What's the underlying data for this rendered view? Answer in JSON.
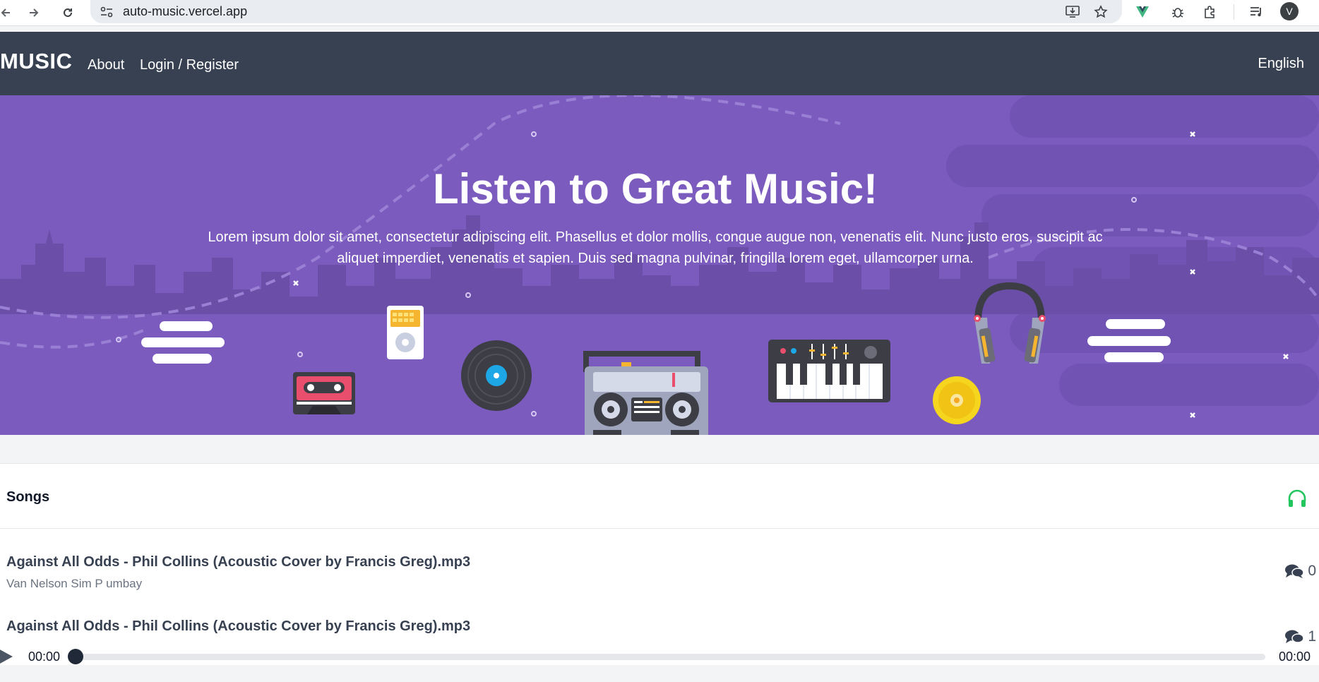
{
  "browser": {
    "url": "auto-music.vercel.app",
    "back_icon": "arrow-left-icon",
    "forward_icon": "arrow-right-icon",
    "reload_icon": "reload-icon",
    "profile_initial": "V"
  },
  "header": {
    "logo": "MUSIC",
    "nav": [
      "About",
      "Login / Register"
    ],
    "language": "English",
    "bg_color": "#374151"
  },
  "hero": {
    "title": "Listen to Great Music!",
    "text": "Lorem ipsum dolor sit amet, consectetur adipiscing elit. Phasellus et dolor mollis, congue augue non, venenatis elit. Nunc justo eros, suscipit ac aliquet imperdiet, venenatis et sapien. Duis sed magna pulvinar, fringilla lorem eget, ullamcorper urna.",
    "bg_color": "#7c5bbf"
  },
  "songs": {
    "title": "Songs",
    "icon": "headphones-icon",
    "icon_color": "#22c55e",
    "items": [
      {
        "title": "Against All Odds - Phil Collins (Acoustic Cover by Francis Greg).mp3",
        "artist": "Van Nelson Sim P umbay",
        "comments": "0"
      },
      {
        "title": "Against All Odds - Phil Collins (Acoustic Cover by Francis Greg).mp3",
        "artist": "",
        "comments": "1"
      }
    ]
  },
  "player": {
    "current_time": "00:00",
    "duration": "00:00",
    "progress": 0
  }
}
